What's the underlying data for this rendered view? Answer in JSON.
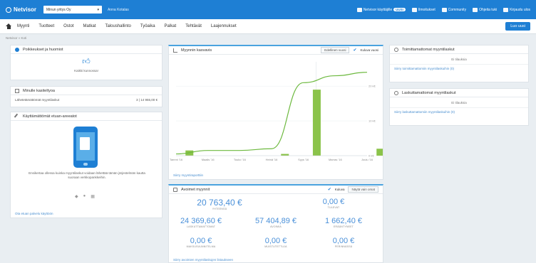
{
  "topbar": {
    "logo": "Netvisor",
    "company": "Minun yritys Oy",
    "user": "Anna Kotalas",
    "links": [
      {
        "label": "Netvisor käyttäjille",
        "badge": "UUSI",
        "icon": "user-icon"
      },
      {
        "label": "Ilmoitukset",
        "icon": "megaphone-icon"
      },
      {
        "label": "Community",
        "icon": "community-icon"
      },
      {
        "label": "Ohjeita tuki",
        "icon": "help-icon"
      },
      {
        "label": "Kirjaudu ulos",
        "icon": "logout-icon"
      }
    ]
  },
  "menu": {
    "items": [
      "Myynti",
      "Tuotteet",
      "Ostot",
      "Matkat",
      "Taloushallinto",
      "Työaika",
      "Palkat",
      "Tehtävät",
      "Laajennukset"
    ],
    "new_button": "Luo uusi"
  },
  "breadcrumb": "Netvisor » Koti",
  "notices": {
    "title": "Poikkeukset ja huomiot",
    "empty": "Kaikki kunnossa!"
  },
  "sales_invoices": {
    "title": "Minulle kasiteltyoa",
    "row_label": "Lähetetämättömät myyntilaskut",
    "row_value": "3 | 14 955,00 €"
  },
  "mobile": {
    "title": "Käyttämättömät etuan-areeatot",
    "text": "Ensikertaa ollessa kuinka myyntilaskut voidaan lähettää tämän järjestelmän kautta suoraan verkkopankkeihin.",
    "link": "Ota etuan palvelu käyttöön"
  },
  "sales_chart": {
    "title": "Myynnin kasvavis",
    "toggle_label": "Edellinen vuosi",
    "check_label": "Kuluva vuosi",
    "link": "Siirry myyntiraporttiin"
  },
  "chart_data": {
    "type": "bar",
    "categories": [
      "Tammi '16",
      "Maalis '16",
      "Touko '16",
      "Heinä '16",
      "Syys '16",
      "Marras '16",
      "Joulu '16"
    ],
    "bar_values": [
      1.5,
      0,
      0,
      0.5,
      19,
      0,
      2
    ],
    "line_values": [
      0.5,
      1.5,
      1.5,
      2,
      21,
      23,
      24
    ],
    "y_ticks": [
      "0 k€",
      "10 k€",
      "20 k€",
      "30 k€"
    ],
    "ylim": [
      0,
      27
    ],
    "title": "Myynnin kasvavis"
  },
  "sales_summary": {
    "title": "Avoimet myynnit",
    "toggle": "Kuluva",
    "button": "Näytä vain omat",
    "metrics": [
      {
        "value": "20 763,40 €",
        "label": "YHTEENSÄ"
      },
      {
        "value": "0,00 €",
        "label": "TULEVAT"
      },
      {
        "value": "24 369,60 €",
        "label": "LASKUTTAMATTOMAT"
      },
      {
        "value": "57 404,89 €",
        "label": "AVOIMIA"
      },
      {
        "value": "1 662,40 €",
        "label": "ERÄÄNTYNEET"
      },
      {
        "value": "0,00 €",
        "label": "MAKSUSUUNNITELMA"
      },
      {
        "value": "0,00 €",
        "label": "MUISTUTETTUJA"
      },
      {
        "value": "0,00 €",
        "label": "PERINNÄSSÄ"
      }
    ],
    "link": "Siirry avoimien myyntilaskujen listaukseen"
  },
  "unfinished": {
    "title": "Toimittamattomat myyntilaskut",
    "empty": "Ei tilauksia",
    "link": "Siirry toimittamattomiin myyntilaskuihin (0)"
  },
  "uninvoiced": {
    "title": "Laskuttamattomat myyntilaskut",
    "empty": "Ei tilauksia",
    "link": "Siirry laskuttamattomiin myyntilaskuihin (0)"
  },
  "colors": {
    "brand": "#1e7fd4",
    "bar": "#8bc34a",
    "line": "#6db93f"
  }
}
